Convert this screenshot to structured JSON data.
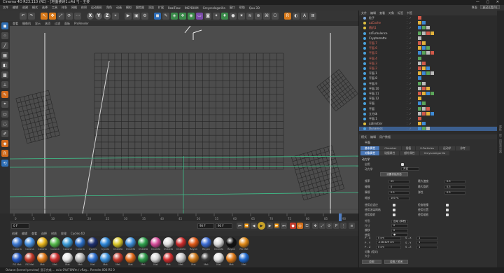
{
  "window": {
    "title": "Cinema 4D R23.110 (RC) - [地面瓷砖1.c4d *] - 主要",
    "controls": "— ▢ ✕"
  },
  "menubar": {
    "items": [
      "文件",
      "编辑",
      "创建",
      "模式",
      "选择",
      "工具",
      "样条",
      "网格",
      "体积",
      "运动图形",
      "角色",
      "动画",
      "模拟",
      "跟踪器",
      "渲染",
      "扩展",
      "RealFlow",
      "INSYDIUM",
      "Greyscalegorilla",
      "窗口",
      "帮助",
      "Quu 3D"
    ],
    "layout_label": "界面",
    "layout_value": "启动 (用户)"
  },
  "toolbar": {
    "buttons": [
      {
        "icon": "undo-icon",
        "glyph": "↶",
        "style": ""
      },
      {
        "icon": "redo-icon",
        "glyph": "↷",
        "style": ""
      },
      {
        "icon": "live-select-icon",
        "glyph": "↖",
        "style": "orange"
      },
      {
        "icon": "move-icon",
        "glyph": "✥",
        "style": "orange"
      },
      {
        "icon": "scale-icon",
        "glyph": "⤢",
        "style": ""
      },
      {
        "icon": "rotate-icon",
        "glyph": "⟳",
        "style": ""
      },
      {
        "icon": "recent-tools-icon",
        "glyph": "⋯",
        "style": ""
      },
      {
        "icon": "x-axis-icon",
        "glyph": "X",
        "style": "axis"
      },
      {
        "icon": "y-axis-icon",
        "glyph": "Y",
        "style": "axis"
      },
      {
        "icon": "z-axis-icon",
        "glyph": "Z",
        "style": "axis"
      },
      {
        "icon": "coord-system-icon",
        "glyph": "⌖",
        "style": ""
      },
      {
        "icon": "render-view-icon",
        "glyph": "▶",
        "style": ""
      },
      {
        "icon": "render-picture-icon",
        "glyph": "▣",
        "style": ""
      },
      {
        "icon": "render-settings-icon",
        "glyph": "⚙",
        "style": ""
      },
      {
        "icon": "cube-icon",
        "glyph": "◼",
        "style": "blue"
      },
      {
        "icon": "pen-icon",
        "glyph": "✎",
        "style": ""
      },
      {
        "icon": "subdivision-icon",
        "glyph": "◈",
        "style": "green"
      },
      {
        "icon": "array-icon",
        "glyph": "❖",
        "style": "green"
      },
      {
        "icon": "boole-icon",
        "glyph": "◉",
        "style": "green"
      },
      {
        "icon": "floor-icon",
        "glyph": "▭",
        "style": "purple"
      },
      {
        "icon": "camera-icon",
        "glyph": "◙",
        "style": ""
      },
      {
        "icon": "light-icon",
        "glyph": "✦",
        "style": ""
      },
      {
        "icon": "deformer-icon",
        "glyph": "♦",
        "style": "green"
      },
      {
        "icon": "field-icon",
        "glyph": "●",
        "style": ""
      },
      {
        "icon": "mograph-icon",
        "glyph": "✷",
        "style": ""
      },
      {
        "icon": "hair-icon",
        "glyph": "≋",
        "style": ""
      },
      {
        "icon": "dynamics-icon",
        "glyph": "⊕",
        "style": ""
      },
      {
        "icon": "xpresso-icon",
        "glyph": "⌘",
        "style": ""
      },
      {
        "icon": "python-icon",
        "glyph": "⎔",
        "style": ""
      },
      {
        "icon": "redshift-icon",
        "glyph": "R",
        "style": "orange"
      },
      {
        "icon": "octane-icon",
        "glyph": "◐",
        "style": ""
      },
      {
        "icon": "arnold-icon",
        "glyph": "A",
        "style": ""
      },
      {
        "icon": "layout-icon",
        "glyph": "⊞",
        "style": ""
      }
    ]
  },
  "left_tools": [
    "cube-icon",
    "polygon-points-icon",
    "edges-icon",
    "polygons-icon",
    "uv-icon",
    "texture-icon",
    "axis-icon",
    "sculpt-icon",
    "snap-icon",
    "workplane-icon",
    "soft-selection-icon",
    "paint-icon",
    "locked-icon",
    "redshift-icon",
    "orbit-icon"
  ],
  "viewport": {
    "menu": [
      "查看",
      "摄像机",
      "显示",
      "选项",
      "过滤",
      "面板",
      "ProRender"
    ]
  },
  "timeline": {
    "ticks": [
      "0",
      "5",
      "10",
      "15",
      "20",
      "25",
      "30",
      "35",
      "40",
      "45",
      "50",
      "55",
      "60",
      "65",
      "70",
      "75",
      "80",
      "85",
      "90"
    ],
    "current_frame": "0 F",
    "start_frame": "0 F",
    "end_frame": "90 F",
    "end_frame2": "90 F"
  },
  "materials": {
    "menu": [
      "创建",
      "编辑",
      "查看",
      "选择",
      "材质",
      "纹理",
      "Cycles 4D"
    ],
    "items": [
      {
        "label": "Corona",
        "color": "#3b77d1"
      },
      {
        "label": "Corona",
        "color": "#4590e0"
      },
      {
        "label": "Corona",
        "color": "#e8b41c"
      },
      {
        "label": "Corona",
        "color": "#54b84a"
      },
      {
        "label": "Corona",
        "color": "#3a9ad6"
      },
      {
        "label": "Corona",
        "color": "#2b6fc8"
      },
      {
        "label": "Cycles",
        "color": "#1d2f6e"
      },
      {
        "label": "Cycles",
        "color": "#2c85d6"
      },
      {
        "label": "OCDefa",
        "color": "#d9c728"
      },
      {
        "label": "OCDefa",
        "color": "#3d8ed8"
      },
      {
        "label": "OCDefa",
        "color": "#2fa04d"
      },
      {
        "label": "OCDefa",
        "color": "#d64c9a"
      },
      {
        "label": "OCDefa",
        "color": "#e0e0e0"
      },
      {
        "label": "OCDefa",
        "color": "#cc2b2b"
      },
      {
        "label": "Rayon",
        "color": "#e05a18"
      },
      {
        "label": "Rayon",
        "color": "#3b6bd3"
      },
      {
        "label": "OCDefa",
        "color": "#dadada"
      },
      {
        "label": "Rayon",
        "color": "#111111"
      },
      {
        "label": "RS Mat",
        "color": "#e08a18"
      },
      {
        "label": "RS Mat",
        "color": "#2255c0"
      },
      {
        "label": "RS Mat",
        "color": "#c23a2a"
      },
      {
        "label": "Mat",
        "color": "#e07a1a"
      },
      {
        "label": "Mat",
        "color": "#cf3030"
      },
      {
        "label": "Mat",
        "color": "#e6e6e6"
      },
      {
        "label": "Mat",
        "color": "#b8b8b8"
      },
      {
        "label": "Mat",
        "color": "#2c6fd1"
      },
      {
        "label": "Mat",
        "color": "#3a8fd9"
      },
      {
        "label": "Mat",
        "color": "#c13a2c"
      },
      {
        "label": "Mat",
        "color": "#e06a1a"
      },
      {
        "label": "Mat",
        "color": "#2e9a4a"
      },
      {
        "label": "Mat",
        "color": "#d6d6d6"
      },
      {
        "label": "Mat",
        "color": "#d12f2f"
      },
      {
        "label": "Mat",
        "color": "#c7c7c7"
      },
      {
        "label": "Mat",
        "color": "#cf7a1a"
      },
      {
        "label": "Mat",
        "color": "#3a3a3a"
      },
      {
        "label": "Mat",
        "color": "#e0e0e0"
      },
      {
        "label": "Mat",
        "color": "#e07b1a"
      },
      {
        "label": "Mat",
        "color": "#1f6ad0"
      }
    ]
  },
  "status": "Octane:[kernel-preview] 显示完成  ... ocio 0%/70Nfm  / vRay... Rrender.000:RS 0",
  "objects": {
    "menu": [
      "文件",
      "编辑",
      "查看",
      "对象",
      "标签",
      "书签"
    ],
    "rows": [
      {
        "name": "粒子",
        "color": "#7da7d8",
        "red": false
      },
      {
        "name": "azCache",
        "color": "#e0c040",
        "red": true
      },
      {
        "name": "随机1",
        "color": "#e0c040",
        "red": true
      },
      {
        "name": "azTurbulence",
        "color": "#4aa3df",
        "red": false
      },
      {
        "name": "Cryptomatte",
        "color": "#4aa3df",
        "red": false
      },
      {
        "name": "平面.7",
        "color": "#4aa3df",
        "red": true
      },
      {
        "name": "平面.6",
        "color": "#4aa3df",
        "red": true
      },
      {
        "name": "平面.5",
        "color": "#4aa3df",
        "red": true
      },
      {
        "name": "平面.4",
        "color": "#4aa3df",
        "red": true
      },
      {
        "name": "平面.3",
        "color": "#4aa3df",
        "red": true
      },
      {
        "name": "平面.2",
        "color": "#4aa3df",
        "red": true
      },
      {
        "name": "平面.1",
        "color": "#4aa3df",
        "red": false
      },
      {
        "name": "平面.8",
        "color": "#4aa3df",
        "red": false
      },
      {
        "name": "平面.9",
        "color": "#4aa3df",
        "red": false
      },
      {
        "name": "平面.10",
        "color": "#4aa3df",
        "red": false
      },
      {
        "name": "平面.11",
        "color": "#4aa3df",
        "red": false
      },
      {
        "name": "平面.12",
        "color": "#4aa3df",
        "red": false
      },
      {
        "name": "平面",
        "color": "#4aa3df",
        "red": false
      },
      {
        "name": "平面",
        "color": "#4aa3df",
        "red": false
      },
      {
        "name": "立方体",
        "color": "#4aa3df",
        "red": false
      },
      {
        "name": "平面.1",
        "color": "#4aa3df",
        "red": false
      },
      {
        "name": "azEmitter",
        "color": "#e0c040",
        "red": false
      },
      {
        "name": "Dynamics",
        "color": "#4aa3df",
        "red": false
      }
    ]
  },
  "attributes": {
    "menu": [
      "模式",
      "编辑",
      "用户数据"
    ],
    "title": "平面",
    "tabs1": [
      "基本属性",
      "Chamber",
      "插值",
      "X-Particles",
      "运动学",
      "参考"
    ],
    "tabs2": [
      "对象属性",
      "碰撞属性",
      "额外属性",
      "Greyscalegorilla"
    ],
    "section": "动力学",
    "fields": [
      {
        "label": "启用",
        "value": "✓"
      },
      {
        "label": "动力学",
        "value": "开启"
      },
      {
        "label": "设置初始形态",
        "value": ""
      }
    ],
    "button_init": "设置初始形态",
    "rows": [
      {
        "l": "频率",
        "v": "25",
        "l2": "最大速度",
        "v2": "0.5"
      },
      {
        "l": "碰撞",
        "v": "0",
        "l2": "最大旋转",
        "v2": "0.5"
      },
      {
        "l": "摩擦",
        "v": "0.5",
        "l2": "弹性",
        "v2": "0.5"
      },
      {
        "l": "缩放",
        "v": "100 %",
        "l2": "",
        "v2": ""
      }
    ],
    "checks": [
      "使用自适应",
      "检查碰撞",
      "使用渲染网格",
      "使用位置",
      "使用旋转",
      "使用缩放"
    ],
    "lower_fields": [
      {
        "l": "外形",
        "v": "自动 (体积)"
      },
      {
        "l": "尺寸",
        "v": "0"
      },
      {
        "l": "偏移",
        "v": "0"
      },
      {
        "l": "使用",
        "v": "●"
      }
    ],
    "xyz": [
      {
        "l": "P . X",
        "v": "0 cm",
        "l2": "S . X",
        "v2": "1"
      },
      {
        "l": "P . Y",
        "v": "-128.429 cm",
        "l2": "S . Y",
        "v2": "1"
      },
      {
        "l": "P . Z",
        "v": "0 cm",
        "l2": "S . Z",
        "v2": "1"
      }
    ],
    "bottom_buttons": [
      "应用",
      "应用 / 关闭"
    ],
    "bottom_labels": [
      "对象 (相对)",
      "大小"
    ]
  },
  "side_strip": "属性 · 层 · 内容浏览器"
}
